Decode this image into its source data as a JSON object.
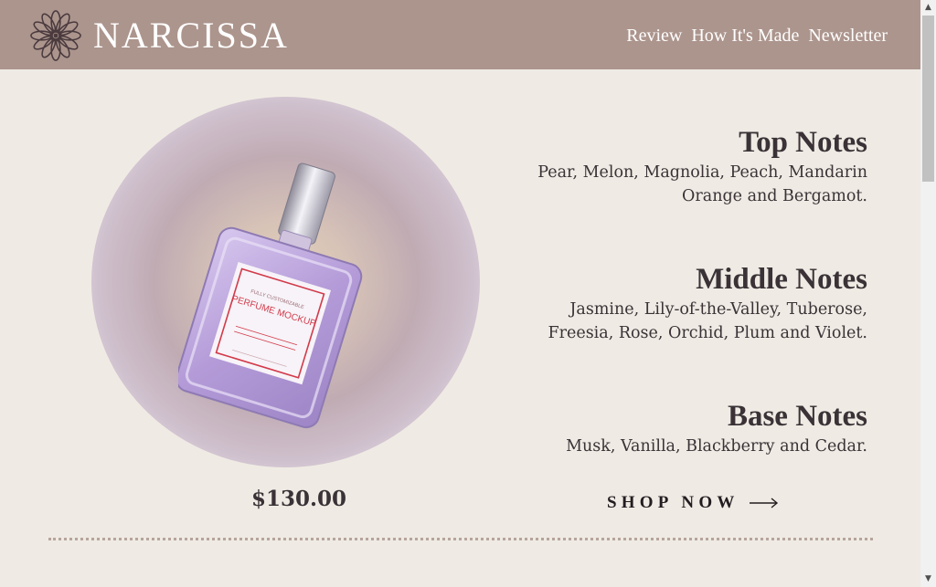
{
  "brand": {
    "name": "NARCISSA",
    "logo_icon": "flower-icon"
  },
  "nav": {
    "items": [
      "Review",
      "How It's Made",
      "Newsletter"
    ]
  },
  "product": {
    "image_label_line1": "FULLY CUSTOMIZABLE",
    "image_label_line2": "PERFUME MOCKUP",
    "price": "$130.00"
  },
  "notes": {
    "top": {
      "title": "Top Notes",
      "line1": "Pear, Melon, Magnolia, Peach, Mandarin",
      "line2": "Orange and Bergamot."
    },
    "middle": {
      "title": "Middle Notes",
      "line1": "Jasmine, Lily-of-the-Valley, Tuberose,",
      "line2": "Freesia, Rose, Orchid, Plum and Violet."
    },
    "base": {
      "title": "Base Notes",
      "line1": "Musk, Vanilla, Blackberry and Cedar."
    }
  },
  "cta": {
    "label": "SHOP NOW",
    "icon": "arrow-right-icon"
  },
  "colors": {
    "header": "#ac958d",
    "background": "#efebe4",
    "text": "#3a3236",
    "bottle": "#b9a0d6",
    "label_red": "#d23a4a"
  }
}
